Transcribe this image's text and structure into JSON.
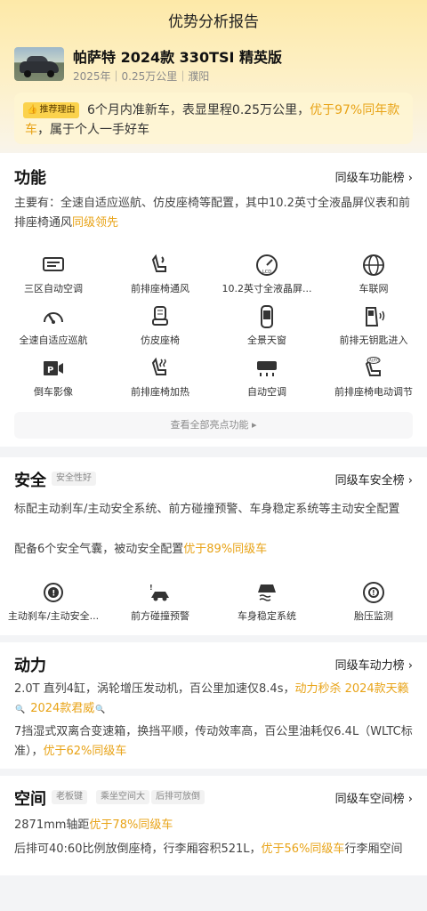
{
  "page_title": "优势分析报告",
  "car": {
    "name": "帕萨特 2024款 330TSI 精英版",
    "meta": "2025年｜0.25万公里｜濮阳"
  },
  "reason": {
    "tag": "推荐理由",
    "text_a": "6个月内准新车，表显里程0.25万公里，",
    "text_hl": "优于97%同年款车",
    "text_b": "，属于个人一手好车"
  },
  "function": {
    "title": "功能",
    "rank_link": "同级车功能榜 ›",
    "desc_a": "主要有：全速自适应巡航、仿皮座椅等配置，其中10.2英寸全液晶屏仪表和前排座椅通风",
    "desc_hl": "同级领先",
    "items": [
      {
        "label": "三区自动空调",
        "icon": "climate-zone-icon"
      },
      {
        "label": "前排座椅通风",
        "icon": "seat-ventilation-icon"
      },
      {
        "label": "10.2英寸全液晶屏...",
        "icon": "lcd-dashboard-icon"
      },
      {
        "label": "车联网",
        "icon": "connected-car-icon"
      },
      {
        "label": "全速自适应巡航",
        "icon": "adaptive-cruise-icon"
      },
      {
        "label": "仿皮座椅",
        "icon": "leather-seat-icon"
      },
      {
        "label": "全景天窗",
        "icon": "panoramic-sunroof-icon"
      },
      {
        "label": "前排无钥匙进入",
        "icon": "keyless-entry-icon"
      },
      {
        "label": "倒车影像",
        "icon": "reverse-camera-icon"
      },
      {
        "label": "前排座椅加热",
        "icon": "seat-heating-icon"
      },
      {
        "label": "自动空调",
        "icon": "auto-ac-icon"
      },
      {
        "label": "前排座椅电动调节",
        "icon": "power-seat-icon"
      }
    ],
    "view_all": "查看全部亮点功能 ▸"
  },
  "safety": {
    "title": "安全",
    "chip": "安全性好",
    "rank_link": "同级车安全榜 ›",
    "desc1": "标配主动刹车/主动安全系统、前方碰撞预警、车身稳定系统等主动安全配置",
    "desc2_a": "配备6个安全气囊，被动安全配置",
    "desc2_hl": "优于89%同级车",
    "items": [
      {
        "label": "主动刹车/主动安全...",
        "icon": "active-brake-icon"
      },
      {
        "label": "前方碰撞预警",
        "icon": "collision-warning-icon"
      },
      {
        "label": "车身稳定系统",
        "icon": "stability-control-icon"
      },
      {
        "label": "胎压监测",
        "icon": "tire-pressure-icon"
      }
    ]
  },
  "power": {
    "title": "动力",
    "rank_link": "同级车动力榜 ›",
    "desc1_a": "2.0T 直列4缸，涡轮增压发动机，百公里加速仅8.4s，",
    "desc1_hl1": "动力秒杀 2024款天籁",
    "desc1_hl2": "2024款君威",
    "desc2_a": "7挡湿式双离合变速箱，换挡平顺，传动效率高，百公里油耗仅6.4L（WLTC标准），",
    "desc2_hl": "优于62%同级车"
  },
  "space": {
    "title": "空间",
    "chips": [
      "老板键",
      "乘坐空间大",
      "后排可放倒"
    ],
    "rank_link": "同级车空间榜 ›",
    "desc1_a": "2871mm轴距",
    "desc1_hl": "优于78%同级车",
    "desc2_a": "后排可40:60比例放倒座椅，行李厢容积521L，",
    "desc2_hl": "优于56%同级车",
    "desc2_b": "行李厢空间"
  },
  "colors": {
    "accent": "#e8a317",
    "tag_bg": "#fbd24c",
    "hero_top": "#fde9a8"
  }
}
